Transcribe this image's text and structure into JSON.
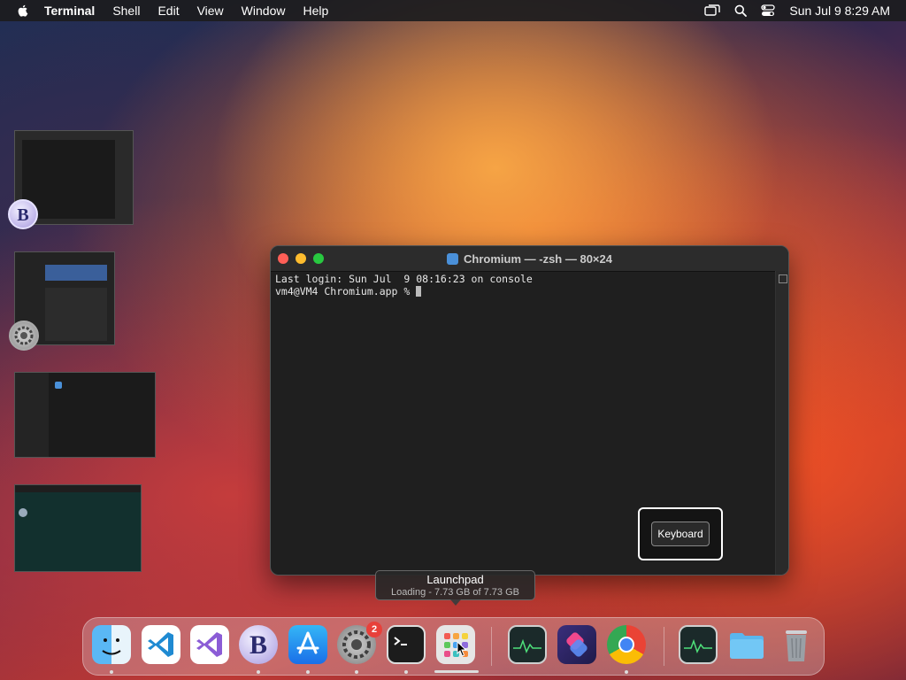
{
  "menubar": {
    "app_name": "Terminal",
    "items": [
      "Shell",
      "Edit",
      "View",
      "Window",
      "Help"
    ],
    "clock": "Sun Jul 9  8:29 AM"
  },
  "terminal": {
    "title": "Chromium — -zsh — 80×24",
    "lines": [
      "Last login: Sun Jul  9 08:16:23 on console",
      "vm4@VM4 Chromium.app % "
    ]
  },
  "overlay": {
    "keyboard_label": "Keyboard"
  },
  "tooltip": {
    "title": "Launchpad",
    "subtitle": "Loading - 7.73 GB of 7.73 GB"
  },
  "dock": {
    "settings_badge": "2"
  },
  "colors": {
    "menubar_bg": "#1c1c1e",
    "terminal_bg": "#1f1f1f",
    "close": "#ff5f57",
    "minimize": "#febc2e",
    "zoom": "#28c840",
    "badge": "#e8403a"
  }
}
